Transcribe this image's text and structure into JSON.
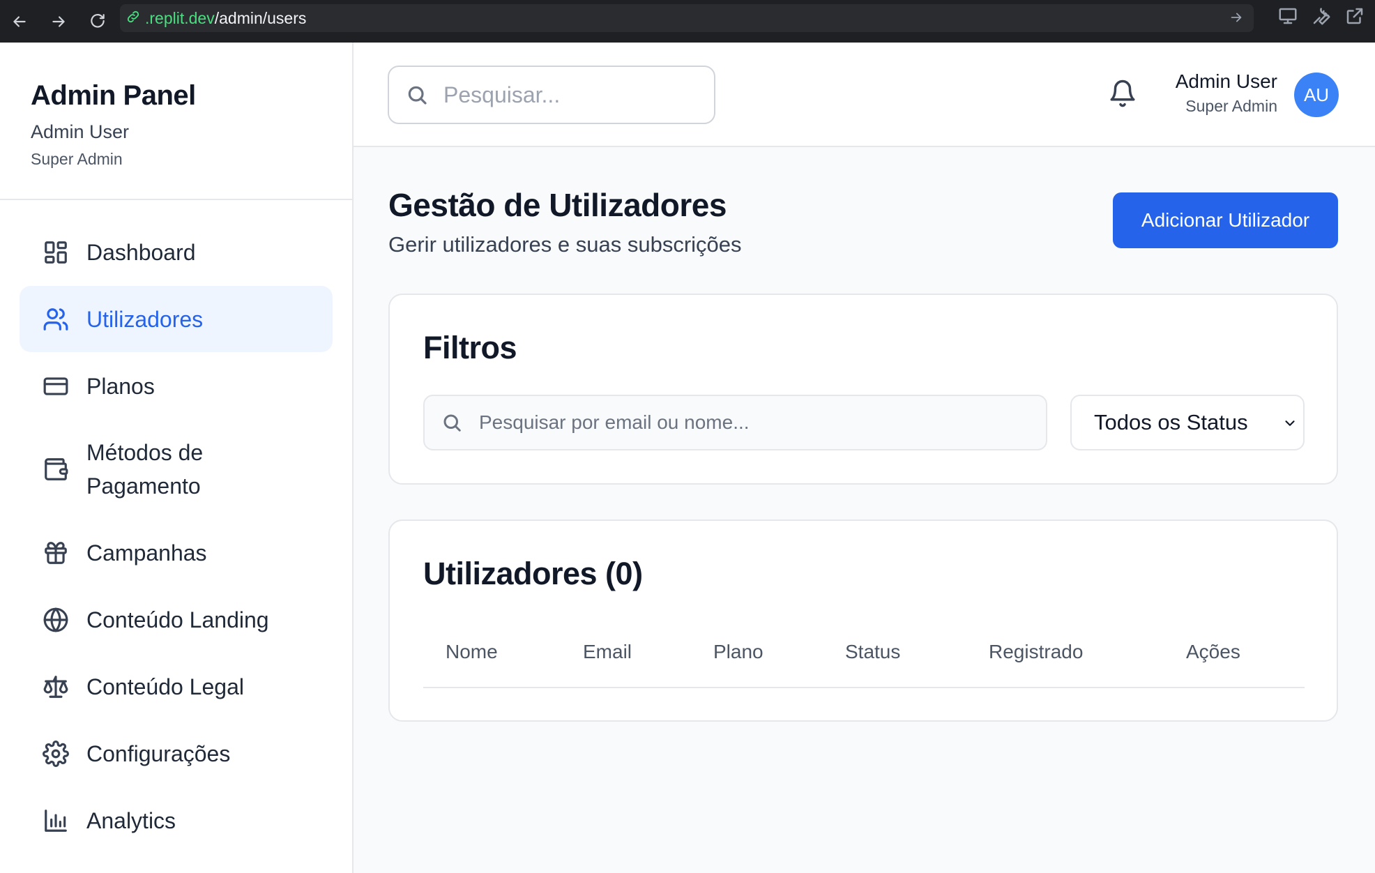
{
  "browser": {
    "url_host": ".replit.dev",
    "url_path": "/admin/users"
  },
  "sidebar": {
    "title": "Admin Panel",
    "user_name": "Admin User",
    "user_role": "Super Admin",
    "items": [
      {
        "label": "Dashboard",
        "icon": "layout-grid-icon",
        "active": false
      },
      {
        "label": "Utilizadores",
        "icon": "users-icon",
        "active": true
      },
      {
        "label": "Planos",
        "icon": "credit-card-icon",
        "active": false
      },
      {
        "label": "Métodos de Pagamento",
        "icon": "wallet-icon",
        "active": false
      },
      {
        "label": "Campanhas",
        "icon": "gift-icon",
        "active": false
      },
      {
        "label": "Conteúdo Landing",
        "icon": "globe-icon",
        "active": false
      },
      {
        "label": "Conteúdo Legal",
        "icon": "scale-icon",
        "active": false
      },
      {
        "label": "Configurações",
        "icon": "gear-icon",
        "active": false
      },
      {
        "label": "Analytics",
        "icon": "bar-chart-icon",
        "active": false
      }
    ]
  },
  "header": {
    "search_placeholder": "Pesquisar...",
    "user_name": "Admin User",
    "user_role": "Super Admin",
    "avatar_initials": "AU"
  },
  "page": {
    "title": "Gestão de Utilizadores",
    "subtitle": "Gerir utilizadores e suas subscrições",
    "add_button": "Adicionar Utilizador"
  },
  "filters": {
    "title": "Filtros",
    "search_placeholder": "Pesquisar por email ou nome...",
    "status_selected": "Todos os Status"
  },
  "users_table": {
    "title": "Utilizadores (0)",
    "columns": [
      "Nome",
      "Email",
      "Plano",
      "Status",
      "Registrado",
      "Ações"
    ],
    "rows": []
  },
  "colors": {
    "accent": "#2563eb",
    "active_bg": "#eff5ff",
    "avatar": "#3b82f6"
  }
}
